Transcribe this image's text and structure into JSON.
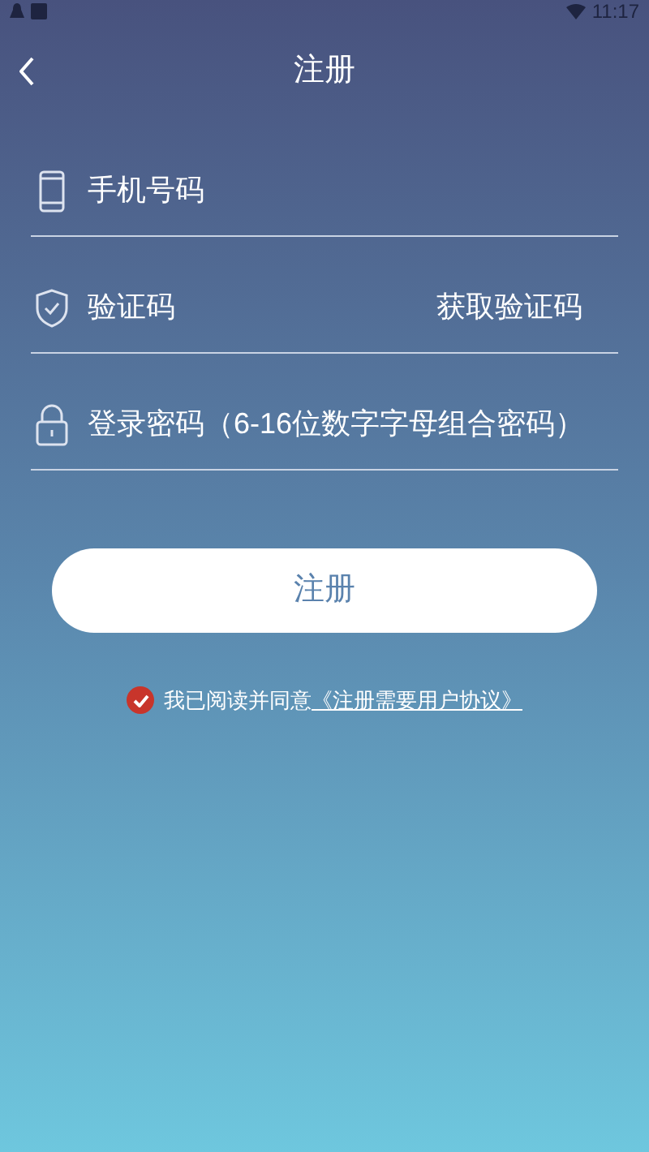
{
  "status_bar": {
    "time": "11:17"
  },
  "header": {
    "title": "注册"
  },
  "fields": [
    {
      "kind": "phone",
      "placeholder": "手机号码"
    },
    {
      "kind": "code",
      "placeholder": "验证码",
      "action": "获取验证码"
    },
    {
      "kind": "password",
      "placeholder": "登录密码（6-16位数字字母组合密码）"
    }
  ],
  "submit_button": "注册",
  "agreement": {
    "checked": true,
    "text": "我已阅读并同意",
    "link": "《注册需要用户协议》"
  }
}
